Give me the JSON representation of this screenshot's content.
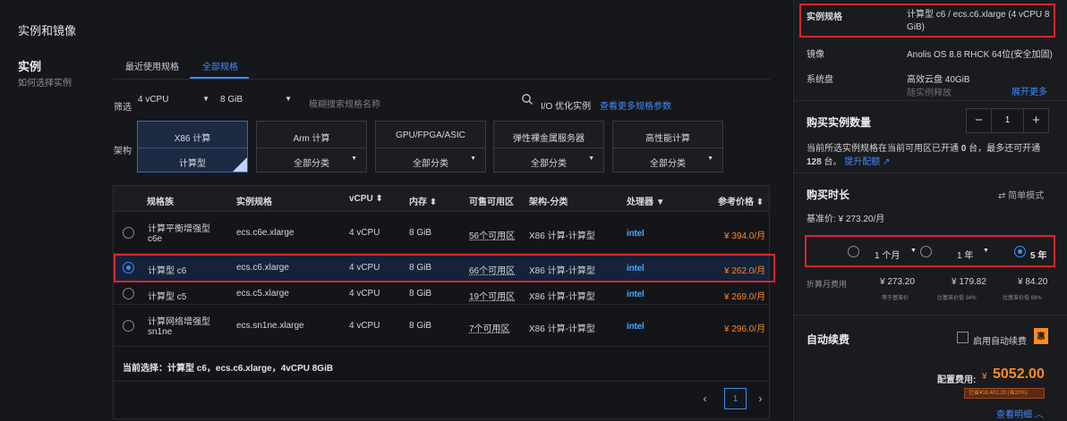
{
  "section": {
    "title": "实例和镜像"
  },
  "instance": {
    "title": "实例",
    "subtitle": "如何选择实例"
  },
  "tabs": [
    {
      "label": "最近使用规格"
    },
    {
      "label": "全部规格"
    }
  ],
  "filter": {
    "label": "筛选",
    "vcpu": "4 vCPU",
    "memory": "8 GiB",
    "search_placeholder": "模糊搜索规格名称",
    "io_label": "I/O 优化实例",
    "more_link": "查看更多规格参数"
  },
  "arch": {
    "label": "架构",
    "boxes": [
      {
        "title": "X86 计算",
        "value": "计算型"
      },
      {
        "title": "Arm 计算",
        "value": "全部分类"
      },
      {
        "title": "GPU/FPGA/ASIC",
        "value": "全部分类"
      },
      {
        "title": "弹性裸金属服务器",
        "value": "全部分类"
      },
      {
        "title": "高性能计算",
        "value": "全部分类"
      }
    ]
  },
  "table": {
    "headers": {
      "family": "规格族",
      "spec": "实例规格",
      "vcpu": "vCPU",
      "memory": "内存",
      "zones": "可售可用区",
      "arch": "架构-分类",
      "cpu": "处理器",
      "price": "参考价格"
    },
    "rows": [
      {
        "family": "计算平衡增强型",
        "family2": "c6e",
        "spec": "ecs.c6e.xlarge",
        "vcpu": "4 vCPU",
        "memory": "8 GiB",
        "zones": "56个可用区",
        "arch": "X86 计算-计算型",
        "cpu": "intel",
        "price": "¥ 394.0/月"
      },
      {
        "family": "计算型 c6",
        "family2": "",
        "spec": "ecs.c6.xlarge",
        "vcpu": "4 vCPU",
        "memory": "8 GiB",
        "zones": "66个可用区",
        "arch": "X86 计算-计算型",
        "cpu": "intel",
        "price": "¥ 262.0/月"
      },
      {
        "family": "计算型 c5",
        "family2": "",
        "spec": "ecs.c5.xlarge",
        "vcpu": "4 vCPU",
        "memory": "8 GiB",
        "zones": "19个可用区",
        "arch": "X86 计算-计算型",
        "cpu": "intel",
        "price": "¥ 269.0/月"
      },
      {
        "family": "计算网络增强型",
        "family2": "sn1ne",
        "spec": "ecs.sn1ne.xlarge",
        "vcpu": "4 vCPU",
        "memory": "8 GiB",
        "zones": "7个可用区",
        "arch": "X86 计算-计算型",
        "cpu": "intel",
        "price": "¥ 296.0/月"
      }
    ],
    "selected_index": 1,
    "current_selection": "当前选择：计算型 c6，ecs.c6.xlarge，4vCPU 8GiB",
    "page": "1",
    "prev": "‹",
    "next": "›"
  },
  "summary": {
    "spec_label": "实例规格",
    "spec_value": "计算型 c6 / ecs.c6.xlarge (4 vCPU 8 GiB)",
    "image_label": "镜像",
    "image_value": "Anolis OS 8.8 RHCK 64位(安全加固)",
    "disk_label": "系统盘",
    "disk_value": "高效云盘 40GiB",
    "disk_value2": "随实例释放",
    "expand": "展开更多"
  },
  "quantity": {
    "title": "购买实例数量",
    "value": "1",
    "minus": "−",
    "plus": "+",
    "note_line1_a": "当前所选实例规格在当前可用区已开通",
    "note_line1_b": "0",
    "note_line1_c": "台，最多还可开通",
    "note_line2_a": "128",
    "note_line2_b": "台。",
    "raise_link": "提升配额"
  },
  "duration": {
    "title": "购买时长",
    "mode": "简单模式",
    "base_price": "基准价: ¥ 273.20/月",
    "options": [
      {
        "label": "1 个月"
      },
      {
        "label": "1 年"
      },
      {
        "label": "5 年"
      }
    ],
    "selected_index": 2,
    "monthly_label": "折算月费用",
    "monthly": [
      "¥ 273.20",
      "¥ 179.82",
      "¥ 84.20"
    ],
    "notes": [
      "等于基准价",
      "比基准价低 34%",
      "比基准价低 69%"
    ]
  },
  "renew": {
    "title": "自动续费",
    "checkbox_label": "启用自动续费",
    "badge": "惠"
  },
  "total": {
    "label": "配置费用:",
    "currency": "¥",
    "amount": "5052.00",
    "discount": "已省¥16,401.20 (省20%)",
    "detail_link": "查看明细"
  },
  "colors": {
    "accent": "#3d8bff",
    "price": "#ff8a1f",
    "highlight": "#d7262e"
  }
}
